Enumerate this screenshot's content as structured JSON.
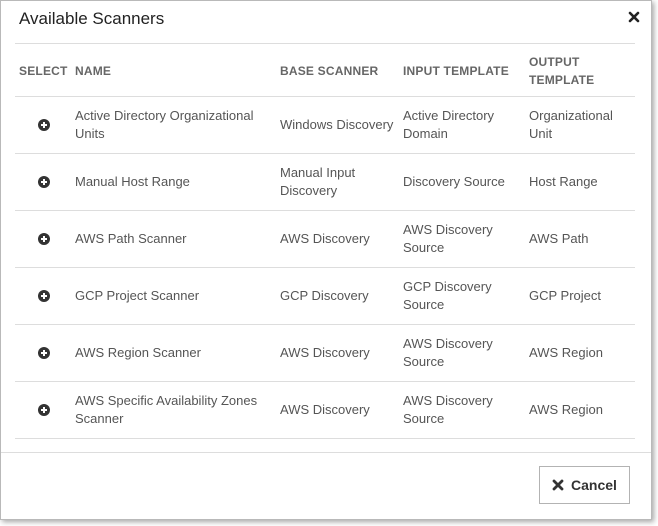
{
  "dialog": {
    "title": "Available Scanners",
    "close_icon": "close-icon",
    "cancel_label": "Cancel",
    "cancel_icon": "close-icon"
  },
  "table": {
    "headers": {
      "select": "SELECT",
      "name": "NAME",
      "base_scanner": "BASE SCANNER",
      "input_template": "INPUT TEMPLATE",
      "output_template": "OUTPUT TEMPLATE"
    },
    "select_icon": "plus-circle-icon",
    "rows": [
      {
        "name": "Active Directory Organizational Units",
        "base_scanner": "Windows Discovery",
        "input_template": "Active Directory Domain",
        "output_template": "Organizational Unit"
      },
      {
        "name": "Manual Host Range",
        "base_scanner": "Manual Input Discovery",
        "input_template": "Discovery Source",
        "output_template": "Host Range"
      },
      {
        "name": "AWS Path Scanner",
        "base_scanner": "AWS Discovery",
        "input_template": "AWS Discovery Source",
        "output_template": "AWS Path"
      },
      {
        "name": "GCP Project Scanner",
        "base_scanner": "GCP Discovery",
        "input_template": "GCP Discovery Source",
        "output_template": "GCP Project"
      },
      {
        "name": "AWS Region Scanner",
        "base_scanner": "AWS Discovery",
        "input_template": "AWS Discovery Source",
        "output_template": "AWS Region"
      },
      {
        "name": "AWS Specific Availability Zones Scanner",
        "base_scanner": "AWS Discovery",
        "input_template": "AWS Discovery Source",
        "output_template": "AWS Region"
      }
    ]
  }
}
